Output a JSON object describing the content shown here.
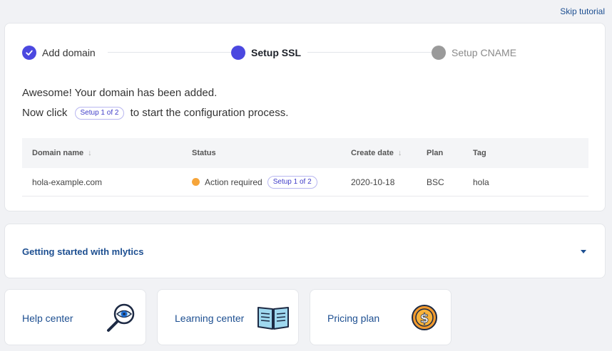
{
  "header": {
    "skip_label": "Skip tutorial"
  },
  "stepper": {
    "steps": [
      {
        "label": "Add domain",
        "state": "completed"
      },
      {
        "label": "Setup SSL",
        "state": "active"
      },
      {
        "label": "Setup CNAME",
        "state": "pending"
      }
    ]
  },
  "message": {
    "line1": "Awesome! Your domain has been added.",
    "line2_before": "Now click",
    "button_label": "Setup 1 of 2",
    "line2_after": "to start the configuration process."
  },
  "table": {
    "columns": [
      {
        "label": "Domain name",
        "sortable": true
      },
      {
        "label": "Status",
        "sortable": false
      },
      {
        "label": "Create date",
        "sortable": true
      },
      {
        "label": "Plan",
        "sortable": false
      },
      {
        "label": "Tag",
        "sortable": false
      }
    ],
    "rows": [
      {
        "domain": "hola-example.com",
        "status": "Action required",
        "status_color": "#f6a53a",
        "action_label": "Setup 1 of 2",
        "create_date": "2020-10-18",
        "plan": "BSC",
        "tag": "hola"
      }
    ]
  },
  "getting_started": {
    "title": "Getting started with mlytics"
  },
  "tiles": [
    {
      "label": "Help center",
      "icon": "magnifier-eye-icon"
    },
    {
      "label": "Learning center",
      "icon": "open-book-icon"
    },
    {
      "label": "Pricing plan",
      "icon": "dollar-coin-icon"
    }
  ],
  "colors": {
    "accent": "#4b48e0",
    "link": "#1d4f91",
    "warning": "#f6a53a",
    "pending": "#9a9a9a"
  }
}
